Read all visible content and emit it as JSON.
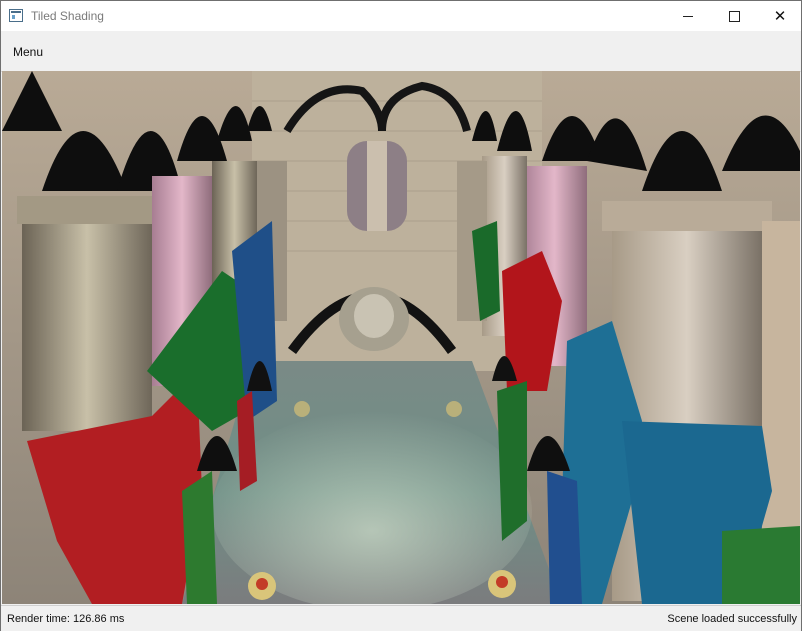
{
  "window": {
    "title": "Tiled Shading"
  },
  "menubar": {
    "items": [
      {
        "label": "Menu"
      }
    ]
  },
  "statusbar": {
    "left": "Render time: 126.86 ms",
    "right": "Scene loaded successfully"
  },
  "icons": {
    "app": "app-window-icon",
    "minimize": "minimize-icon",
    "maximize": "maximize-icon",
    "close": "close-icon"
  },
  "scene": {
    "description_colors": {
      "banner_red": "#b21e22",
      "banner_green": "#1a6e2c",
      "banner_blue": "#1f6f96"
    }
  }
}
